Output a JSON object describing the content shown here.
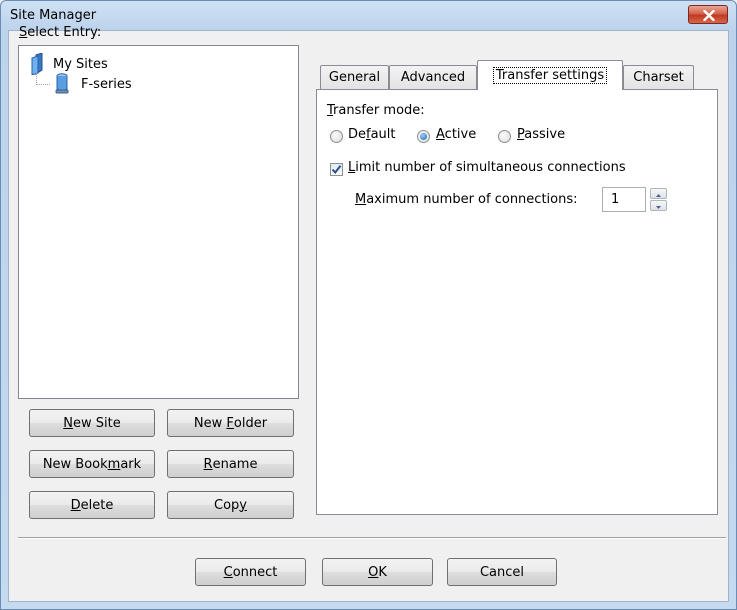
{
  "window": {
    "title": "Site Manager"
  },
  "select_entry": {
    "label_prefix": "",
    "label_mnemonic": "S",
    "label_rest": "elect Entry:"
  },
  "tree": {
    "root": {
      "label": "My Sites",
      "icon": "folder-icon"
    },
    "child": {
      "label": "F-series",
      "icon": "server-icon"
    }
  },
  "buttons": {
    "new_site": {
      "pre": "",
      "mn": "N",
      "post": "ew Site"
    },
    "new_folder": {
      "pre": "New ",
      "mn": "F",
      "post": "older"
    },
    "new_bookmark": {
      "pre": "New Book",
      "mn": "m",
      "post": "ark"
    },
    "rename": {
      "pre": "",
      "mn": "R",
      "post": "ename"
    },
    "delete": {
      "pre": "",
      "mn": "D",
      "post": "elete"
    },
    "copy": {
      "pre": "Cop",
      "mn": "y",
      "post": ""
    },
    "connect": {
      "pre": "",
      "mn": "C",
      "post": "onnect"
    },
    "ok": {
      "pre": "",
      "mn": "O",
      "post": "K"
    },
    "cancel": {
      "label": "Cancel"
    }
  },
  "tabs": [
    {
      "label": "General",
      "active": false
    },
    {
      "label": "Advanced",
      "active": false
    },
    {
      "label": "Transfer settings",
      "active": true
    },
    {
      "label": "Charset",
      "active": false
    }
  ],
  "transfer": {
    "mode_label": {
      "mn": "T",
      "post": "ransfer mode:"
    },
    "radios": [
      {
        "pre": "De",
        "mn": "f",
        "post": "ault",
        "checked": false
      },
      {
        "pre": "",
        "mn": "A",
        "post": "ctive",
        "checked": true
      },
      {
        "pre": "",
        "mn": "P",
        "post": "assive",
        "checked": false
      }
    ],
    "limit_checkbox": {
      "mn": "L",
      "post": "imit number of simultaneous connections",
      "checked": true
    },
    "max_label": {
      "mn": "M",
      "post": "aximum number of connections:"
    },
    "max_value": "1"
  },
  "colors": {
    "accent_radio": "#1c5fa8",
    "close_button": "#c13a22",
    "titlebar": "#bcd3ec"
  }
}
